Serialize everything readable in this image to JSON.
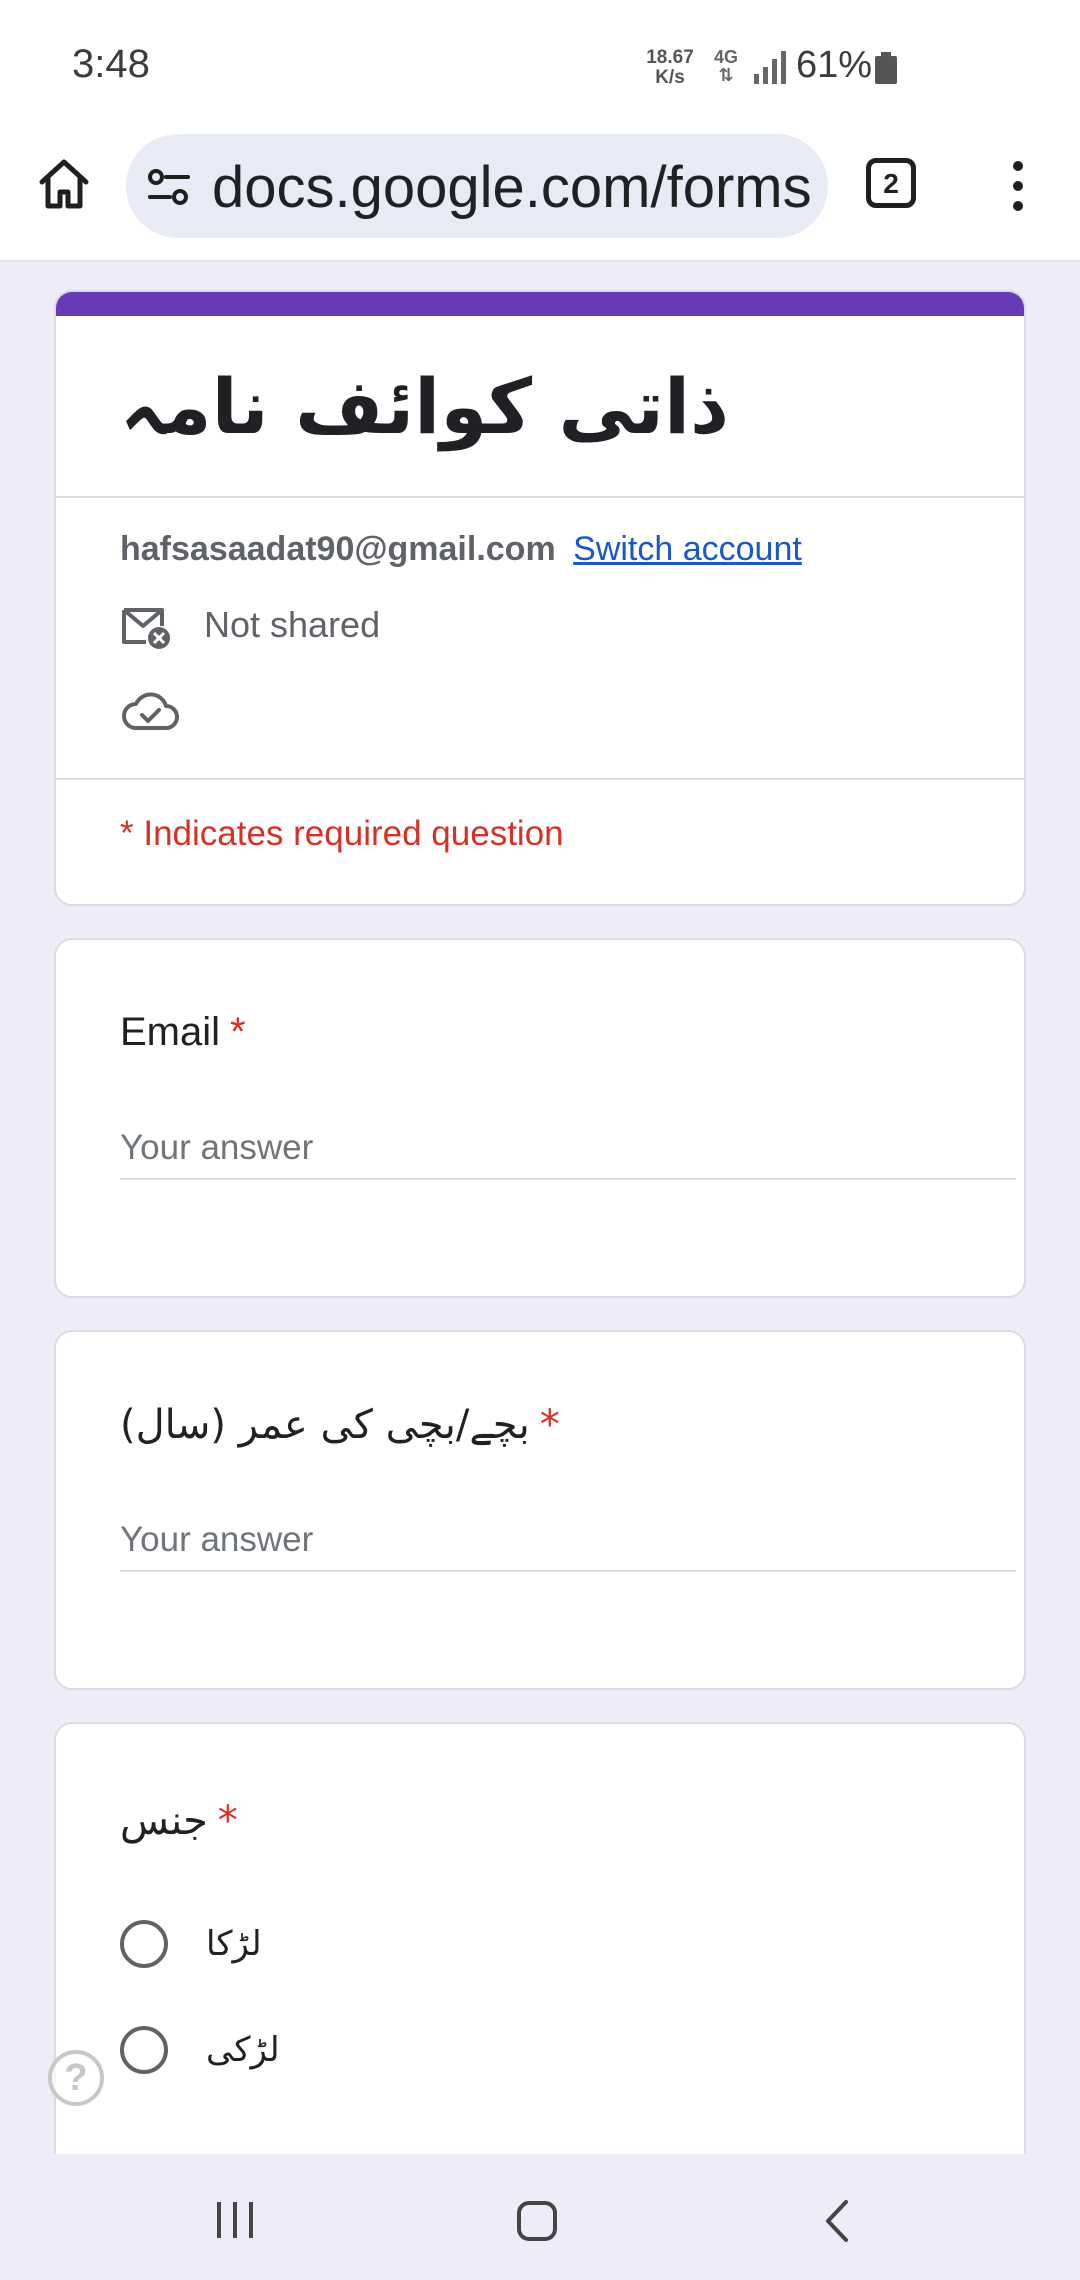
{
  "status_bar": {
    "time": "3:48",
    "net_speed_value": "18.67",
    "net_speed_unit": "K/s",
    "network_type": "4G",
    "battery_percent": "61%"
  },
  "browser": {
    "url": "docs.google.com/forms",
    "tab_count": "2"
  },
  "form": {
    "title": "ذاتی کوائف نامہ",
    "account_email": "hafsasaadat90@gmail.com",
    "switch_account_label": "Switch account",
    "not_shared_label": "Not shared",
    "required_note": "* Indicates required question",
    "accent_color": "#673ab7",
    "required_color": "#d93025"
  },
  "questions": [
    {
      "title": "Email",
      "required_mark": "*",
      "placeholder": "Your answer"
    },
    {
      "title": "بچے/بچی کی عمر (سال)",
      "required_mark": "*",
      "placeholder": "Your answer"
    },
    {
      "title": "جنس",
      "required_mark": "*",
      "options": [
        "لڑکا",
        "لڑکی"
      ]
    }
  ],
  "help_button_label": "?"
}
